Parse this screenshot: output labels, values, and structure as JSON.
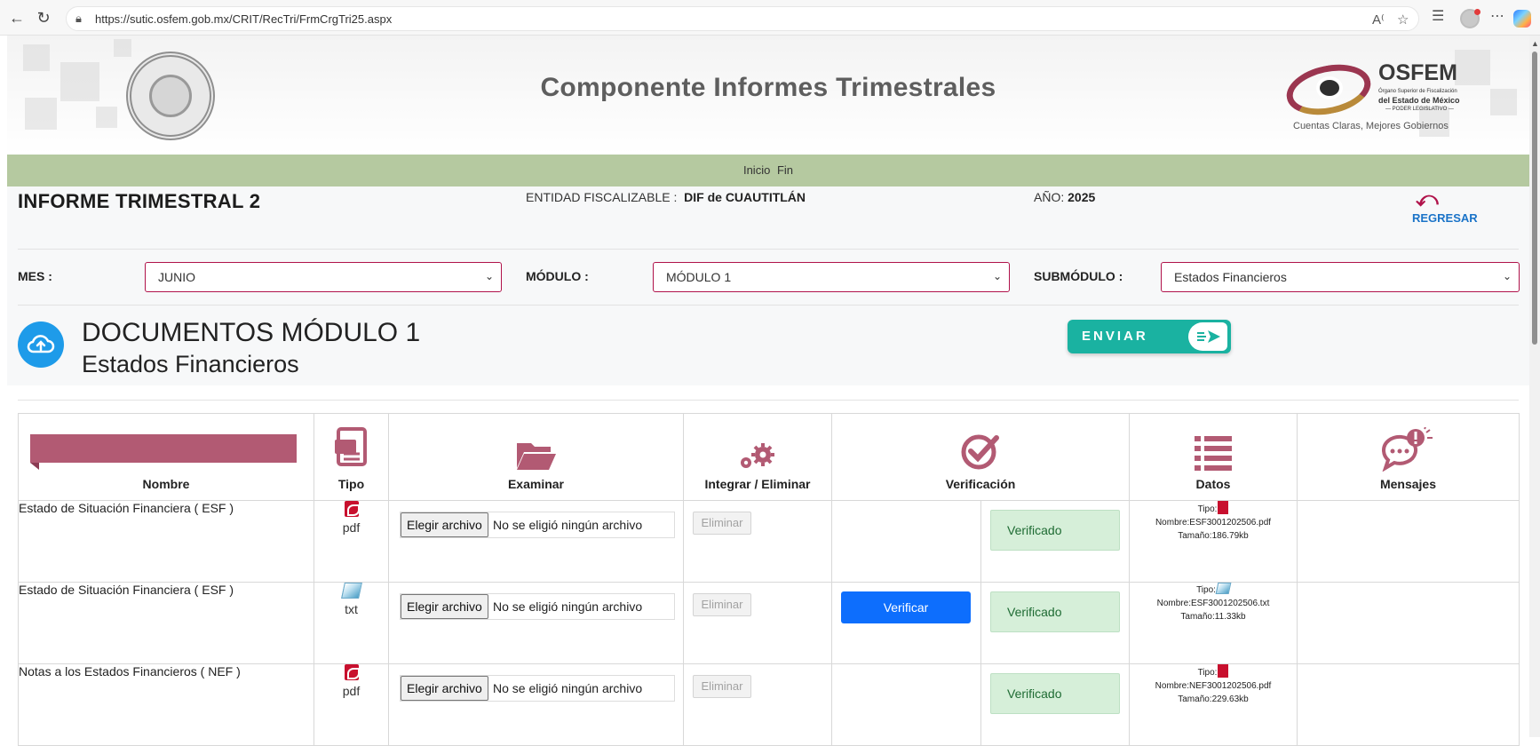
{
  "browser": {
    "url": "https://sutic.osfem.gob.mx/CRIT/RecTri/FrmCrgTri25.aspx"
  },
  "header": {
    "title": "Componente Informes Trimestrales",
    "logo_name": "OSFEM",
    "logo_line1": "Órgano Superior de Fiscalización",
    "logo_line2": "del Estado de México",
    "logo_line3": "— PODER LEGISLATIVO —",
    "logo_tagline": "Cuentas Claras, Mejores Gobiernos"
  },
  "menu": {
    "items": [
      "Inicio",
      "Fin"
    ]
  },
  "info": {
    "informe_title": "INFORME TRIMESTRAL 2",
    "entidad_label": "ENTIDAD FISCALIZABLE :",
    "entidad_value": "DIF de CUAUTITLÁN",
    "anio_label": "AÑO:",
    "anio_value": "2025",
    "regresar_label": "REGRESAR"
  },
  "filters": {
    "mes_label": "MES :",
    "mes_value": "JUNIO",
    "modulo_label": "MÓDULO :",
    "modulo_value": "MÓDULO 1",
    "submodulo_label": "SUBMÓDULO :",
    "submodulo_value": "Estados Financieros"
  },
  "documents": {
    "title": "DOCUMENTOS MÓDULO 1",
    "subtitle": "Estados Financieros",
    "send_label": "ENVIAR"
  },
  "table": {
    "headers": {
      "nombre": "Nombre",
      "tipo": "Tipo",
      "examinar": "Examinar",
      "integrar": "Integrar / Eliminar",
      "verificacion": "Verificación",
      "datos": "Datos",
      "mensajes": "Mensajes"
    },
    "file_button_label": "Elegir archivo",
    "file_status": "No se eligió ningún archivo",
    "eliminar_label": "Eliminar",
    "verificar_label": "Verificar",
    "verificado_label": "Verificado",
    "rows": [
      {
        "nombre": "Estado de Situación Financiera ( ESF )",
        "tipo": "pdf",
        "datos_tipo": "Tipo:",
        "datos_nombre": "Nombre:ESF3001202506.pdf",
        "datos_tamano": "Tamaño:186.79kb"
      },
      {
        "nombre": "Estado de Situación Financiera ( ESF )",
        "tipo": "txt",
        "datos_tipo": "Tipo:",
        "datos_nombre": "Nombre:ESF3001202506.txt",
        "datos_tamano": "Tamaño:11.33kb"
      },
      {
        "nombre": "Notas a los Estados Financieros ( NEF )",
        "tipo": "pdf",
        "datos_tipo": "Tipo:",
        "datos_nombre": "Nombre:NEF3001202506.pdf",
        "datos_tamano": "Tamaño:229.63kb"
      }
    ]
  },
  "colors": {
    "accent": "#b0124a",
    "menu_bar": "#b5c9a0",
    "send_button": "#1ab2a1",
    "verify_button": "#0d6efd",
    "verified_badge": "#d6efd9"
  }
}
